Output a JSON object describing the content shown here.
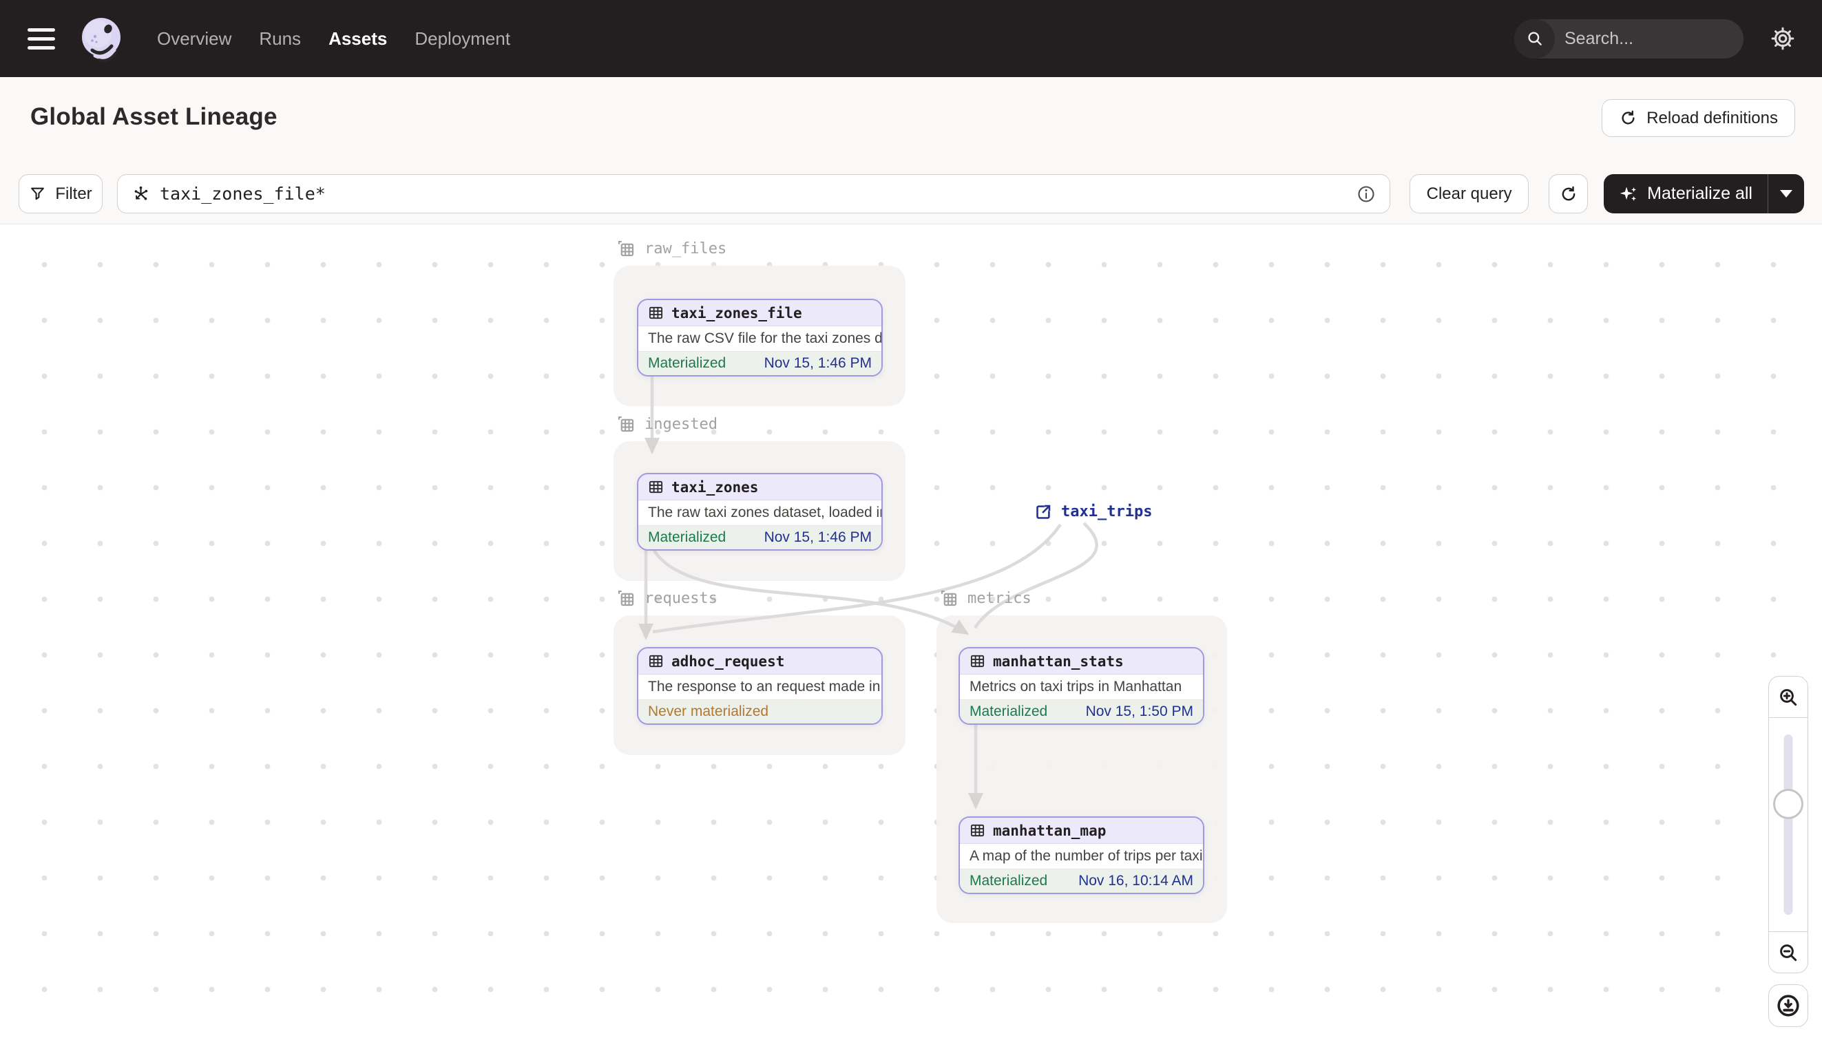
{
  "topnav": {
    "items": [
      {
        "label": "Overview"
      },
      {
        "label": "Runs"
      },
      {
        "label": "Assets"
      },
      {
        "label": "Deployment"
      }
    ],
    "active_item": "Assets",
    "search": {
      "placeholder": "Search...",
      "shortcut": "/"
    }
  },
  "header": {
    "title": "Global Asset Lineage",
    "reload_label": "Reload definitions"
  },
  "toolbar": {
    "filter_label": "Filter",
    "query_value": "taxi_zones_file*",
    "clear_label": "Clear query",
    "materialize_label": "Materialize all"
  },
  "graph": {
    "groups": [
      {
        "name": "raw_files"
      },
      {
        "name": "ingested"
      },
      {
        "name": "requests"
      },
      {
        "name": "metrics"
      }
    ],
    "nodes": [
      {
        "name": "taxi_zones_file",
        "description": "The raw CSV file for the taxi zones dat…",
        "status": "Materialized",
        "timestamp": "Nov 15, 1:46 PM"
      },
      {
        "name": "taxi_zones",
        "description": "The raw taxi zones dataset, loaded int…",
        "status": "Materialized",
        "timestamp": "Nov 15, 1:46 PM"
      },
      {
        "name": "adhoc_request",
        "description": "The response to an request made in th…",
        "status": "Never materialized",
        "timestamp": ""
      },
      {
        "name": "manhattan_stats",
        "description": "Metrics on taxi trips in Manhattan",
        "status": "Materialized",
        "timestamp": "Nov 15, 1:50 PM"
      },
      {
        "name": "manhattan_map",
        "description": "A map of the number of trips per taxi z…",
        "status": "Materialized",
        "timestamp": "Nov 16, 10:14 AM"
      }
    ],
    "external_node": {
      "name": "taxi_trips"
    }
  },
  "colors": {
    "topnav_bg": "#231f20",
    "header_bg": "#faf9f7",
    "node_border": "#a198e0",
    "node_header_bg": "#ebe9fa",
    "node_footer_bg": "#ecf1ec",
    "materialized_green": "#1b7a4b",
    "never_materialized_amber": "#b5772d",
    "timestamp_navy": "#21318f",
    "edge_gray": "#dcdada"
  }
}
